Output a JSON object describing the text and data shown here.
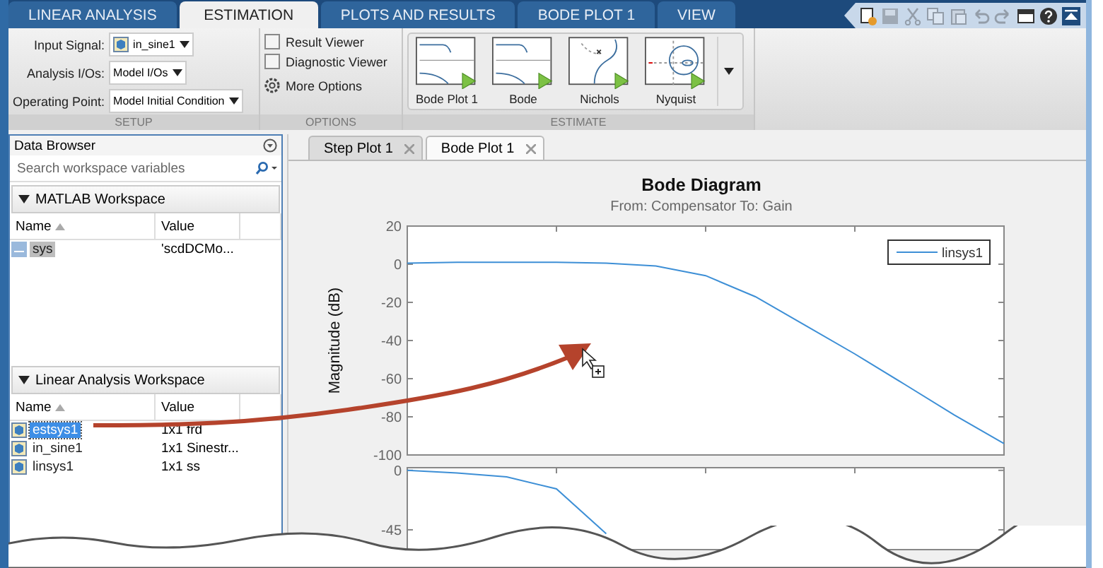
{
  "app_tabs": [
    {
      "label": "LINEAR ANALYSIS",
      "selected": false
    },
    {
      "label": "ESTIMATION",
      "selected": true
    },
    {
      "label": "PLOTS AND RESULTS",
      "selected": false
    },
    {
      "label": "BODE PLOT 1",
      "selected": false
    },
    {
      "label": "VIEW",
      "selected": false
    }
  ],
  "quick_access": [
    {
      "kind": "new",
      "disabled": false
    },
    {
      "kind": "save",
      "disabled": true
    },
    {
      "kind": "cut",
      "disabled": true
    },
    {
      "kind": "copy",
      "disabled": true
    },
    {
      "kind": "paste",
      "disabled": true
    },
    {
      "kind": "undo",
      "disabled": true
    },
    {
      "kind": "redo",
      "disabled": true
    },
    {
      "kind": "layout",
      "disabled": false
    },
    {
      "kind": "help",
      "disabled": false
    },
    {
      "kind": "collapse",
      "disabled": false
    }
  ],
  "setup": {
    "section": "SETUP",
    "fields": [
      {
        "label": "Input Signal:",
        "value": "in_sine1",
        "icon": true
      },
      {
        "label": "Analysis I/Os:",
        "value": "Model I/Os",
        "icon": false
      },
      {
        "label": "Operating Point:",
        "value": "Model Initial Condition",
        "icon": false
      }
    ]
  },
  "options": {
    "section": "OPTIONS",
    "checkboxes": [
      {
        "label": "Result Viewer",
        "checked": false
      },
      {
        "label": "Diagnostic Viewer",
        "checked": false
      }
    ],
    "more": "More Options"
  },
  "estimate": {
    "section": "ESTIMATE",
    "gallery": [
      {
        "kind": "bode",
        "label": "Bode Plot 1"
      },
      {
        "kind": "bode",
        "label": "Bode"
      },
      {
        "kind": "nichols",
        "label": "Nichols"
      },
      {
        "kind": "nyquist",
        "label": "Nyquist"
      }
    ]
  },
  "data_browser": {
    "title": "Data Browser",
    "search": {
      "placeholder": "Search workspace variables"
    },
    "sections": [
      {
        "title": "MATLAB Workspace",
        "expanded": true,
        "focused": false,
        "columns": [
          "Name",
          "Value"
        ],
        "rows": [
          {
            "kind": "char",
            "name": "sys",
            "value": "'scdDCMo...",
            "selected": true
          }
        ]
      },
      {
        "title": "Linear Analysis Workspace",
        "expanded": true,
        "focused": true,
        "columns": [
          "Name",
          "Value"
        ],
        "rows": [
          {
            "kind": "model",
            "name": "estsys1",
            "value": "1x1 frd",
            "selected": true
          },
          {
            "kind": "model",
            "name": "in_sine1",
            "value": "1x1 Sinestr...",
            "selected": false
          },
          {
            "kind": "model",
            "name": "linsys1",
            "value": "1x1 ss",
            "selected": false
          }
        ]
      }
    ]
  },
  "doc_tabs": [
    {
      "label": "Step Plot 1",
      "selected": false
    },
    {
      "label": "Bode Plot 1",
      "selected": true
    }
  ],
  "plot": {
    "subtitle": "From: Compensator  To: Gain",
    "magnitude": {
      "chart_data": {
        "type": "line",
        "title": "Bode Diagram",
        "ylabel": "Magnitude (dB)",
        "ylim": [
          -100,
          20
        ],
        "yticks": [
          20,
          0,
          -20,
          -40,
          -60,
          -80,
          -100
        ],
        "series": [
          {
            "name": "linsys1",
            "color": "#3d8fd6",
            "values": [
              0.5,
              1,
              1,
              1,
              0.5,
              -1,
              -6,
              -17,
              -32,
              -47,
              -63,
              -79,
              -94
            ]
          }
        ]
      }
    },
    "phase": {
      "chart_data": {
        "type": "line",
        "ylim": [
          -60,
          2
        ],
        "yticks": [
          0,
          -45
        ],
        "series": [
          {
            "color": "#3d8fd6",
            "values": [
              0,
              -2,
              -5,
              -14,
              -48
            ]
          }
        ]
      }
    }
  }
}
